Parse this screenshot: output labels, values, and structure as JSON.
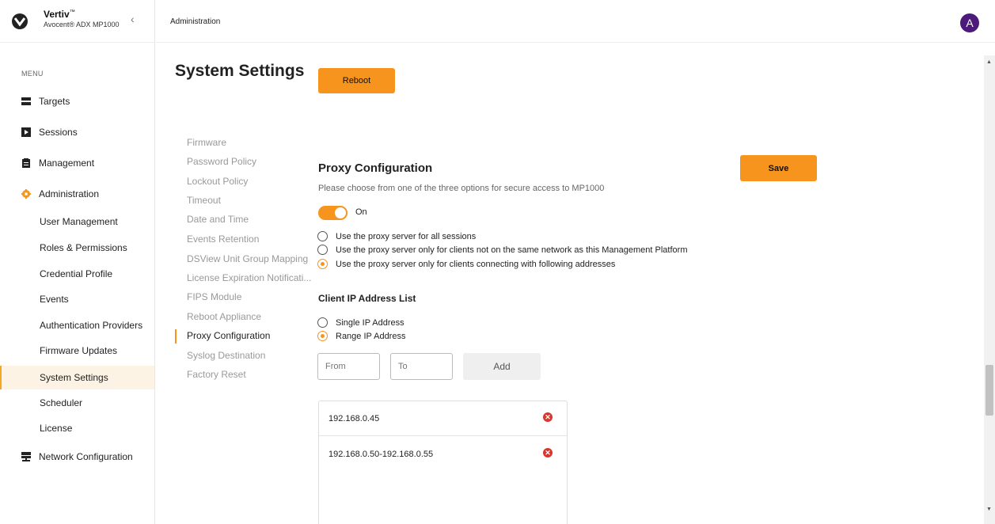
{
  "brand": {
    "name": "Vertiv",
    "trademark": "™",
    "product": "Avocent® ADX MP1000",
    "collapse_icon": "chevron-left-icon"
  },
  "sidebar": {
    "menu_label": "MENU",
    "items": [
      {
        "label": "Targets",
        "icon": "targets-icon"
      },
      {
        "label": "Sessions",
        "icon": "sessions-icon"
      },
      {
        "label": "Management",
        "icon": "clipboard-icon"
      },
      {
        "label": "Administration",
        "icon": "gear-icon"
      },
      {
        "label": "Network Configuration",
        "icon": "network-icon"
      }
    ],
    "admin_subitems": [
      {
        "label": "User Management"
      },
      {
        "label": "Roles & Permissions"
      },
      {
        "label": "Credential Profile"
      },
      {
        "label": "Events"
      },
      {
        "label": "Authentication Providers"
      },
      {
        "label": "Firmware Updates"
      },
      {
        "label": "System Settings",
        "active": true
      },
      {
        "label": "Scheduler"
      },
      {
        "label": "License"
      }
    ]
  },
  "header": {
    "breadcrumb": "Administration",
    "avatar_initial": "A",
    "avatar_color": "#4b1a7a"
  },
  "main": {
    "title": "System Settings",
    "reboot_label": "Reboot",
    "settings_nav": [
      {
        "label": "Firmware"
      },
      {
        "label": "Password Policy"
      },
      {
        "label": "Lockout Policy"
      },
      {
        "label": "Timeout"
      },
      {
        "label": "Date and Time"
      },
      {
        "label": "Events Retention"
      },
      {
        "label": "DSView Unit Group Mapping"
      },
      {
        "label": "License Expiration Notificati..."
      },
      {
        "label": "FIPS Module"
      },
      {
        "label": "Reboot Appliance"
      },
      {
        "label": "Proxy Configuration",
        "active": true
      },
      {
        "label": "Syslog Destination"
      },
      {
        "label": "Factory Reset"
      }
    ],
    "proxy": {
      "title": "Proxy Configuration",
      "save_label": "Save",
      "description": "Please choose from one of the three options for secure access to MP1000",
      "toggle_label": "On",
      "toggle_on": true,
      "options": [
        {
          "label": "Use the proxy server for all sessions",
          "checked": false
        },
        {
          "label": "Use the proxy server only for clients not on the same network as this Management Platform",
          "checked": false
        },
        {
          "label": "Use the proxy server only for clients connecting with following addresses",
          "checked": true
        }
      ],
      "client_list_title": "Client IP Address List",
      "ip_modes": [
        {
          "label": "Single IP Address",
          "checked": false
        },
        {
          "label": "Range IP Address",
          "checked": true
        }
      ],
      "from_placeholder": "From",
      "to_placeholder": "To",
      "add_label": "Add",
      "ip_entries": [
        {
          "value": "192.168.0.45"
        },
        {
          "value": "192.168.0.50-192.168.0.55"
        }
      ]
    }
  },
  "colors": {
    "accent": "#f7941d",
    "remove": "#d9362c",
    "active_bg": "#fdf3e4"
  }
}
